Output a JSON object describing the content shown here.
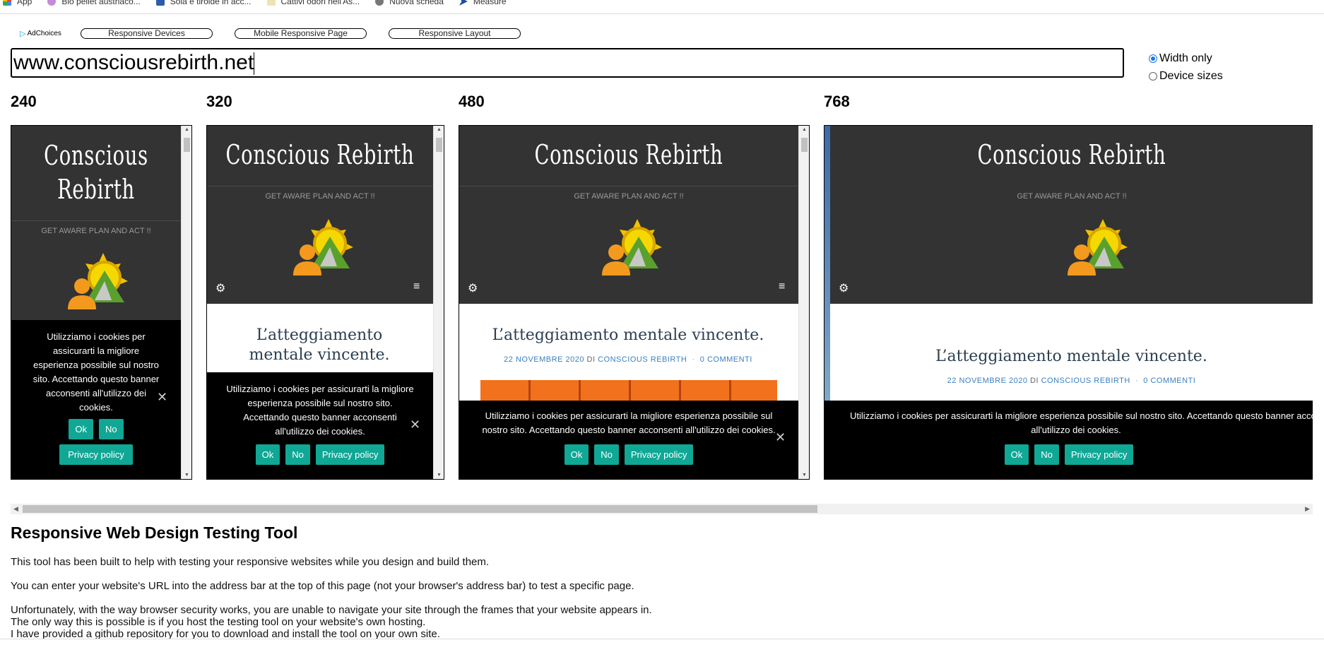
{
  "bookmarks": [
    {
      "label": "App",
      "icon": "apps-grid-icon",
      "color": "#4285f4"
    },
    {
      "label": "Bio pellet austriaco...",
      "icon": "flower-icon",
      "color": "#c48bd6"
    },
    {
      "label": "Soia e tiroide in acc...",
      "icon": "site-favicon-icon",
      "color": "#2a5caa"
    },
    {
      "label": "Cattivi odori nell'As...",
      "icon": "leaf-icon",
      "color": "#d8b84a"
    },
    {
      "label": "Nuova scheda",
      "icon": "globe-icon",
      "color": "#666666"
    },
    {
      "label": "Measure",
      "icon": "measure-icon",
      "color": "#1a4da0"
    }
  ],
  "ads": {
    "adchoices": "AdChoices",
    "buttons": [
      "Responsive Devices",
      "Mobile Responsive Page",
      "Responsive Layout"
    ]
  },
  "url": "www.consciousrebirth.net",
  "radios": {
    "width_only": "Width only",
    "device_sizes": "Device sizes"
  },
  "frames": [
    {
      "width_label": "240"
    },
    {
      "width_label": "320"
    },
    {
      "width_label": "480"
    },
    {
      "width_label": "768"
    }
  ],
  "site": {
    "title": "Conscious Rebirth",
    "title_line1": "Conscious",
    "title_line2": "Rebirth",
    "tagline": "GET AWARE PLAN AND ACT !!",
    "post_title": "L’atteggiamento mentale vincente.",
    "post_title_line1": "L’atteggiamento",
    "post_title_line2": "mentale vincente.",
    "meta_date": "22 NOVEMBRE 2020",
    "meta_by": "DI",
    "meta_author": "CONSCIOUS REBIRTH",
    "meta_sep": "·",
    "meta_comments": "0 COMMENTI"
  },
  "cookie": {
    "text": "Utilizziamo i cookies per assicurarti la migliore esperienza possibile sul nostro sito. Accettando questo banner acconsenti all'utilizzo dei cookies.",
    "text_240": [
      "Utilizziamo i cookies per",
      "assicurarti la migliore",
      "esperienza possibile sul nostro",
      "sito. Accettando questo banner",
      "acconsenti all'utilizzo dei",
      "cookies."
    ],
    "text_320": [
      "Utilizziamo i cookies per assicurarti la migliore",
      "esperienza possibile sul nostro sito.",
      "Accettando questo banner acconsenti",
      "all'utilizzo dei cookies."
    ],
    "text_480": [
      "Utilizziamo i cookies per assicurarti la migliore esperienza possibile sul",
      "nostro sito. Accettando questo banner acconsenti all'utilizzo dei cookies."
    ],
    "text_768": [
      "Utilizziamo i cookies per assicurarti la migliore esperienza possibile sul nostro sito. Accettando questo banner acco",
      "all'utilizzo dei cookies."
    ],
    "ok": "Ok",
    "no": "No",
    "privacy": "Privacy policy",
    "close": "✕"
  },
  "info": {
    "heading": "Responsive Web Design Testing Tool",
    "p1": "This tool has been built to help with testing your responsive websites while you design and build them.",
    "p2": "You can enter your website's URL into the address bar at the top of this page (not your browser's address bar) to test a specific page.",
    "p3a": "Unfortunately, with the way browser security works, you are unable to navigate your site through the frames that your website appears in.",
    "p3b": "The only way this is possible is if you host the testing tool on your website's own hosting.",
    "p3c": "I have provided a github repository for you to download and install the tool on your own site."
  },
  "colors": {
    "header_bg": "#333333",
    "button_teal": "#10a795",
    "link_blue": "#3a7fc1"
  }
}
